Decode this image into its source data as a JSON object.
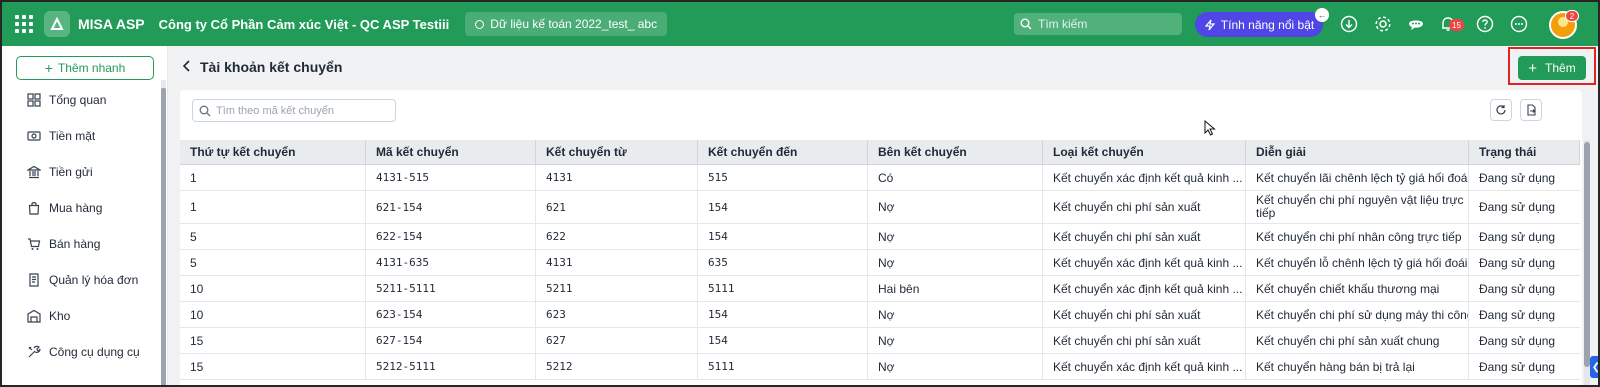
{
  "app": {
    "name": "MISA ASP",
    "company": "Công ty Cổ Phần Cảm xúc Việt - QC ASP Testiii",
    "dataset": "Dữ liệu kế toán 2022_test_ abc"
  },
  "topbar": {
    "search_placeholder": "Tìm kiếm",
    "feature_label": "Tính năng nổi bật",
    "notifications_count": "15",
    "avatar_badge": "2"
  },
  "sidebar": {
    "quick_add_label": "Thêm nhanh",
    "items": [
      {
        "label": "Tổng quan",
        "icon": "grid-icon"
      },
      {
        "label": "Tiền mặt",
        "icon": "cash-icon"
      },
      {
        "label": "Tiền gửi",
        "icon": "bank-icon"
      },
      {
        "label": "Mua hàng",
        "icon": "bag-icon"
      },
      {
        "label": "Bán hàng",
        "icon": "cart-icon"
      },
      {
        "label": "Quản lý hóa đơn",
        "icon": "invoice-icon"
      },
      {
        "label": "Kho",
        "icon": "warehouse-icon"
      },
      {
        "label": "Công cụ dụng cụ",
        "icon": "tools-icon"
      }
    ]
  },
  "page": {
    "title": "Tài khoản kết chuyển",
    "add_label": "Thêm",
    "search_placeholder": "Tìm theo mã kết chuyển"
  },
  "table": {
    "columns": [
      "Thứ tự kết chuyển",
      "Mã kết chuyển",
      "Kết chuyển từ",
      "Kết chuyển đến",
      "Bên kết chuyển",
      "Loại kết chuyển",
      "Diễn giải",
      "Trạng thái"
    ],
    "rows": [
      [
        "1",
        "4131-515",
        "4131",
        "515",
        "Có",
        "Kết chuyển xác định kết quả kinh ...",
        "Kết chuyển lãi chênh lệch tỷ giá hối đoái",
        "Đang sử dụng"
      ],
      [
        "1",
        "621-154",
        "621",
        "154",
        "Nợ",
        "Kết chuyển chi phí sản xuất",
        "Kết chuyển chi phí nguyên vật liệu trực tiếp",
        "Đang sử dụng"
      ],
      [
        "5",
        "622-154",
        "622",
        "154",
        "Nợ",
        "Kết chuyển chi phí sản xuất",
        "Kết chuyển chi phí nhân công trực tiếp",
        "Đang sử dụng"
      ],
      [
        "5",
        "4131-635",
        "4131",
        "635",
        "Nợ",
        "Kết chuyển xác định kết quả kinh ...",
        "Kết chuyển lỗ chênh lệch tỷ giá hối đoái",
        "Đang sử dụng"
      ],
      [
        "10",
        "5211-5111",
        "5211",
        "5111",
        "Hai bên",
        "Kết chuyển xác định kết quả kinh ...",
        "Kết chuyển chiết khấu thương mại",
        "Đang sử dụng"
      ],
      [
        "10",
        "623-154",
        "623",
        "154",
        "Nợ",
        "Kết chuyển chi phí sản xuất",
        "Kết chuyển chi phí sử dụng máy thi công",
        "Đang sử dụng"
      ],
      [
        "15",
        "627-154",
        "627",
        "154",
        "Nợ",
        "Kết chuyển chi phí sản xuất",
        "Kết chuyển chi phí sản xuất chung",
        "Đang sử dụng"
      ],
      [
        "15",
        "5212-5111",
        "5212",
        "5111",
        "Nợ",
        "Kết chuyển xác định kết quả kinh ...",
        "Kết chuyển hàng bán bị trả lại",
        "Đang sử dụng"
      ]
    ]
  },
  "colors": {
    "brand": "#219b57",
    "feature": "#4f46e5",
    "highlight": "#e02424"
  }
}
